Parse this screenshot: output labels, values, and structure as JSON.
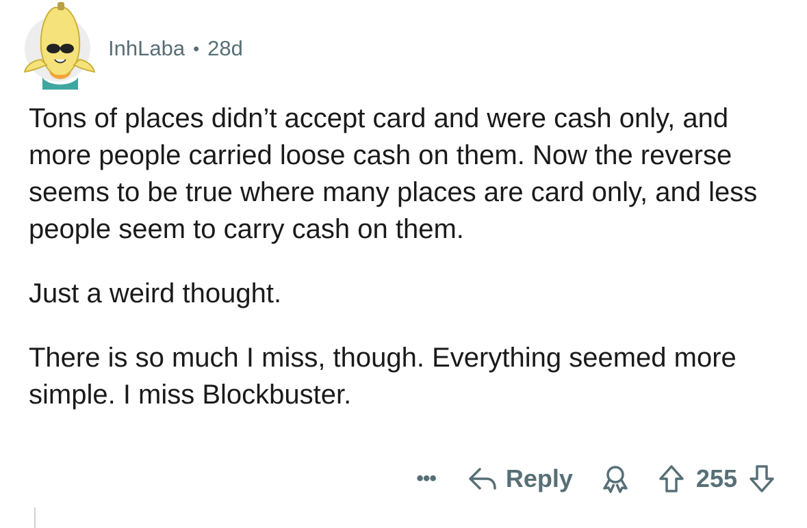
{
  "comment": {
    "username": "InhLaba",
    "separator": "•",
    "age": "28d",
    "paragraphs": [
      "Tons of places didn’t accept card and were cash only, and more people carried loose cash on them. Now the reverse seems to be true where many places are card only, and less people seem to carry cash on them.",
      "Just a weird thought.",
      "There is so much I miss, though. Everything seemed more simple. I miss Blockbuster."
    ]
  },
  "actions": {
    "more_label": "•••",
    "reply_label": "Reply",
    "score": "255"
  },
  "icons": {
    "avatar": "banana-snoo-avatar",
    "reply": "reply-arrow-icon",
    "award": "award-icon",
    "upvote": "upvote-arrow-icon",
    "downvote": "downvote-arrow-icon"
  },
  "colors": {
    "meta_gray": "#576f76",
    "text": "#1a1a1b",
    "avatar_bg": "#ededed"
  }
}
